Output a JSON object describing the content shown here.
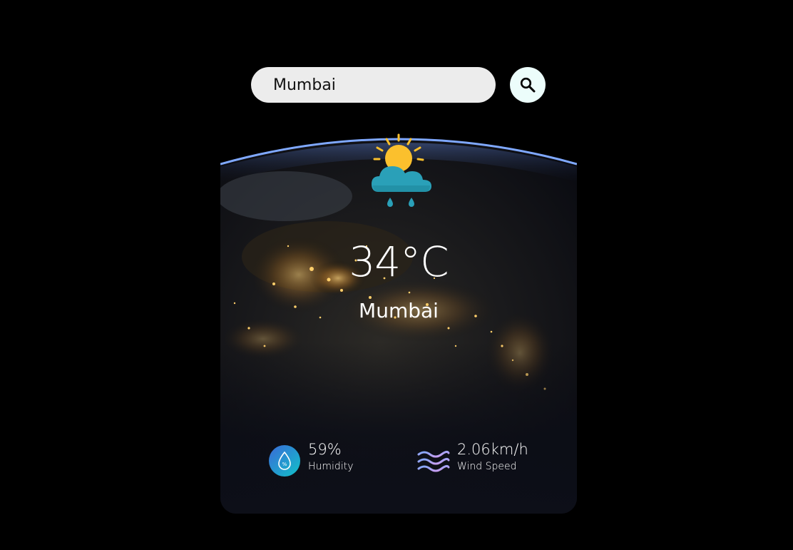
{
  "search": {
    "value": "Mumbai",
    "button_icon": "search-icon"
  },
  "weather": {
    "icon": "sun-cloud-rain-icon",
    "temperature": "34°C",
    "city": "Mumbai"
  },
  "details": {
    "humidity": {
      "icon": "humidity-drop-icon",
      "value": "59%",
      "label": "Humidity"
    },
    "wind": {
      "icon": "wind-icon",
      "value": "2.06km/h",
      "label": "Wind Speed"
    }
  },
  "colors": {
    "page_background": "#000000",
    "search_field": "#ececec",
    "search_button": "#ecfdfb",
    "cloud": "#2aa0b8",
    "sun": "#fbc02d",
    "humidity_icon": "#1aa3c9",
    "wind_icon": "#b59cf0"
  }
}
